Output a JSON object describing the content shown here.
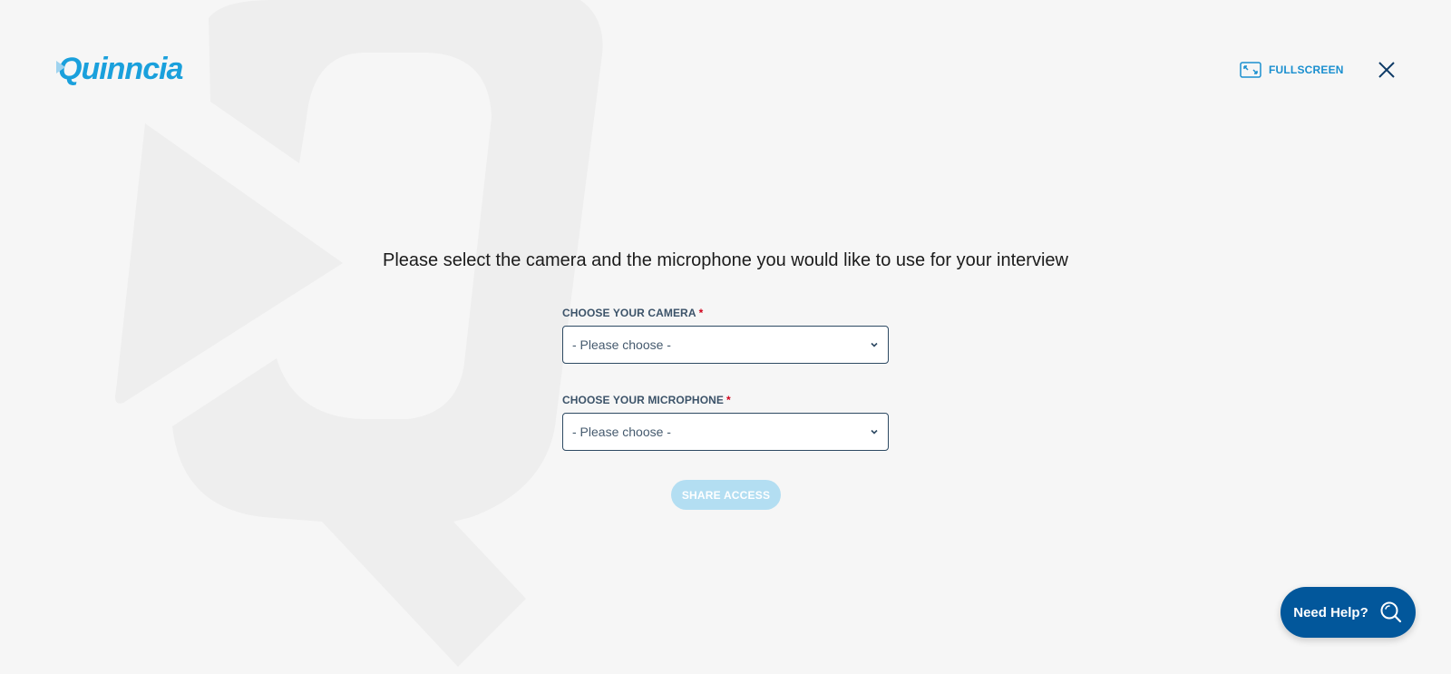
{
  "brand": {
    "name": "Quinncia",
    "accent": "#1aa0dc",
    "dark": "#02579b"
  },
  "header": {
    "fullscreen_label": "FULLSCREEN",
    "fullscreen_icon": "fullscreen-icon",
    "close_icon": "close-icon"
  },
  "main": {
    "headline": "Please select the camera and the microphone you would like to use for your interview",
    "camera": {
      "label": "CHOOSE YOUR CAMERA",
      "required_mark": "*",
      "value": "- Please choose -"
    },
    "microphone": {
      "label": "CHOOSE YOUR MICROPHONE",
      "required_mark": "*",
      "value": "- Please choose -"
    },
    "share_button": "SHARE ACCESS"
  },
  "help": {
    "label": "Need Help?",
    "icon": "search-icon"
  }
}
